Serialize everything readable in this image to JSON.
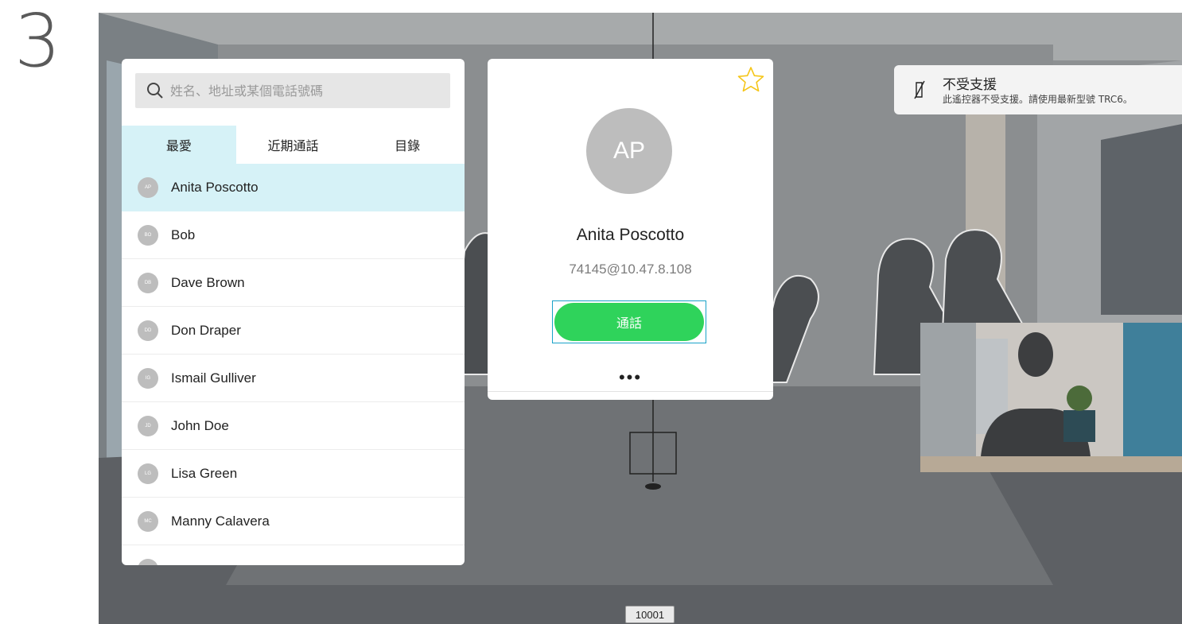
{
  "step_number": "3",
  "search": {
    "placeholder": "姓名、地址或某個電話號碼"
  },
  "tabs": [
    {
      "label": "最愛",
      "active": true
    },
    {
      "label": "近期通話",
      "active": false
    },
    {
      "label": "目錄",
      "active": false
    }
  ],
  "contacts": [
    {
      "initials": "AP",
      "name": "Anita Poscotto",
      "selected": true
    },
    {
      "initials": "BO",
      "name": "Bob",
      "selected": false
    },
    {
      "initials": "DB",
      "name": "Dave Brown",
      "selected": false
    },
    {
      "initials": "DD",
      "name": "Don Draper",
      "selected": false
    },
    {
      "initials": "IG",
      "name": "Ismail Gulliver",
      "selected": false
    },
    {
      "initials": "JD",
      "name": "John Doe",
      "selected": false
    },
    {
      "initials": "LG",
      "name": "Lisa Green",
      "selected": false
    },
    {
      "initials": "MC",
      "name": "Manny Calavera",
      "selected": false
    }
  ],
  "detail": {
    "initials": "AP",
    "name": "Anita Poscotto",
    "address": "74145@10.47.8.108",
    "call_label": "通話",
    "more_label": "•••",
    "favorite_icon": "star-outline-icon"
  },
  "notification": {
    "icon": "remote-unsupported-icon",
    "title": "不受支援",
    "body": "此遙控器不受支援。請使用最新型號 TRC6。"
  },
  "bottom_number": "10001",
  "colors": {
    "selected_row": "#d6f2f7",
    "call_green": "#2fd35b",
    "focus_border": "#1aa2c8",
    "star": "#f5c518",
    "avatar_grey": "#bdbdbd"
  }
}
